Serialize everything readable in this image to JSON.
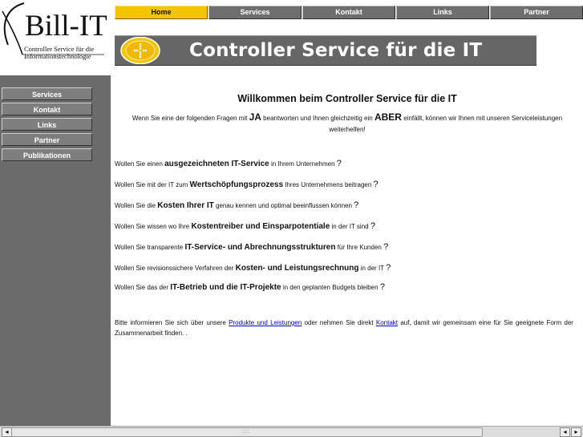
{
  "logo": {
    "title": "Bill-IT",
    "subtitle_line1": "Controller Service für die",
    "subtitle_line2": "Informationstechnologie"
  },
  "topnav": [
    {
      "label": "Home",
      "active": true
    },
    {
      "label": "Services",
      "active": false
    },
    {
      "label": "Kontakt",
      "active": false
    },
    {
      "label": "Links",
      "active": false
    },
    {
      "label": "Partner",
      "active": false
    }
  ],
  "banner": {
    "title": "Controller Service für die IT"
  },
  "sidebar": [
    {
      "label": "Services"
    },
    {
      "label": "Kontakt"
    },
    {
      "label": "Links"
    },
    {
      "label": "Partner"
    },
    {
      "label": "Publikationen"
    }
  ],
  "main": {
    "heading": "Willkommen beim Controller Service für die IT",
    "intro_a": "Wenn Sie eine der folgenden Fragen mit ",
    "intro_ja": "JA",
    "intro_b": " beantworten und Ihnen gleichzeitig ein ",
    "intro_aber": "ABER",
    "intro_c": " einfällt, können wir Ihnen mit unseren Serviceleistungen weiterhelfen!",
    "questions": [
      {
        "pre": "Wollen Sie einen ",
        "bold": "ausgezeichneten IT-Service",
        "post": " in Ihrem Unternehmen ",
        "qm": "?"
      },
      {
        "pre": "Wollen Sie mit der IT zum ",
        "bold": "Wertschöpfungsprozess",
        "post": " Ihres Unternehmens beitragen ",
        "qm": "?"
      },
      {
        "pre": "Wollen Sie die ",
        "bold": "Kosten Ihrer IT",
        "post": " genau kennen und optimal beeinflussen können ",
        "qm": "?"
      },
      {
        "pre": "Wollen Sie wissen wo Ihre ",
        "bold": "Kostentreiber und Einsparpotentiale",
        "post": " in der IT sind ",
        "qm": "?"
      },
      {
        "pre": "Wollen Sie transparente ",
        "bold": "IT-Service- und Abrechnungsstrukturen",
        "post": " für Ihre Kunden ",
        "qm": "?"
      },
      {
        "pre": "Wollen Sie revisionssichere Verfahren der ",
        "bold": "Kosten- und Leistungsrechnung",
        "post": " in der IT ",
        "qm": "?"
      },
      {
        "pre": "Wollen Sie das der ",
        "bold": "IT-Betrieb und die IT-Projekte",
        "post": " in den geplanten Budgets bleiben ",
        "qm": "?"
      }
    ],
    "outro_a": "Bitte informieren Sie sich über unsere ",
    "outro_link1": "Produkte und Leistungen",
    "outro_b": " oder nehmen Sie direkt ",
    "outro_link2": "Kontakt",
    "outro_c": " auf, damit wir gemeinsam eine für Sie geeignete Form der Zusammenarbeit finden. ."
  },
  "scrollbar": {
    "left_arrow": "◂",
    "right_arrow": "▸",
    "grip": "::::::"
  },
  "colors": {
    "accent": "#f5c400",
    "sidebar_bg": "#6b6b6b",
    "banner_bg": "#666666",
    "link": "#0000cc"
  }
}
